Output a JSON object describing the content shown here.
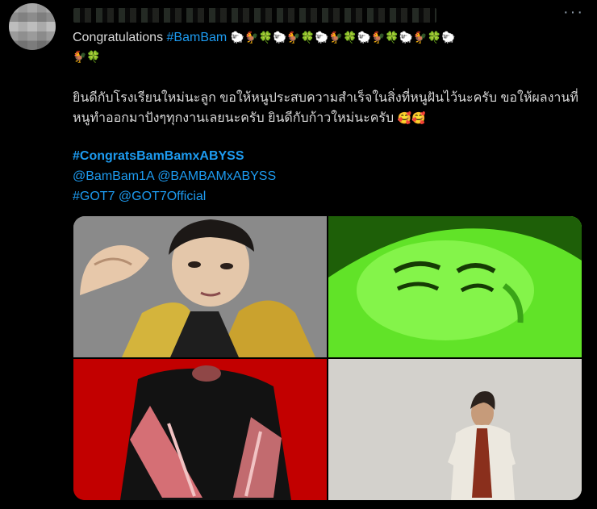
{
  "tweet": {
    "text_prefix": "Congratulations ",
    "hashtag_bambam": "#BamBam",
    "emoji_line1": "🐑🐓🍀🐑🐓🍀🐑🐓🍀🐑🐓🍀🐑🐓🍀🐑",
    "emoji_line2": "🐓🍀",
    "thai_text": "ยินดีกับโรงเรียนใหม่นะลูก ขอให้หนูประสบความสำเร็จในสิ่งที่หนูฝันไว้นะครับ ขอให้ผลงานที่หนูทำออกมาปังๆทุกงานเลยนะครับ ยินดีกับก้าวใหม่นะครับ",
    "thai_emoji": "🥰🥰",
    "hashtag_main": "#CongratsBamBamxABYSS",
    "mention1": "@BamBam1A",
    "mention2": "@BAMBAMxABYSS",
    "hashtag_got7": "#GOT7",
    "mention3": "@GOT7Official"
  },
  "header": {
    "more_label": "···"
  },
  "colors": {
    "background": "#000000",
    "text": "#d9d9d9",
    "link": "#1d9bf0"
  },
  "icons": {
    "more": "more-options-icon"
  }
}
